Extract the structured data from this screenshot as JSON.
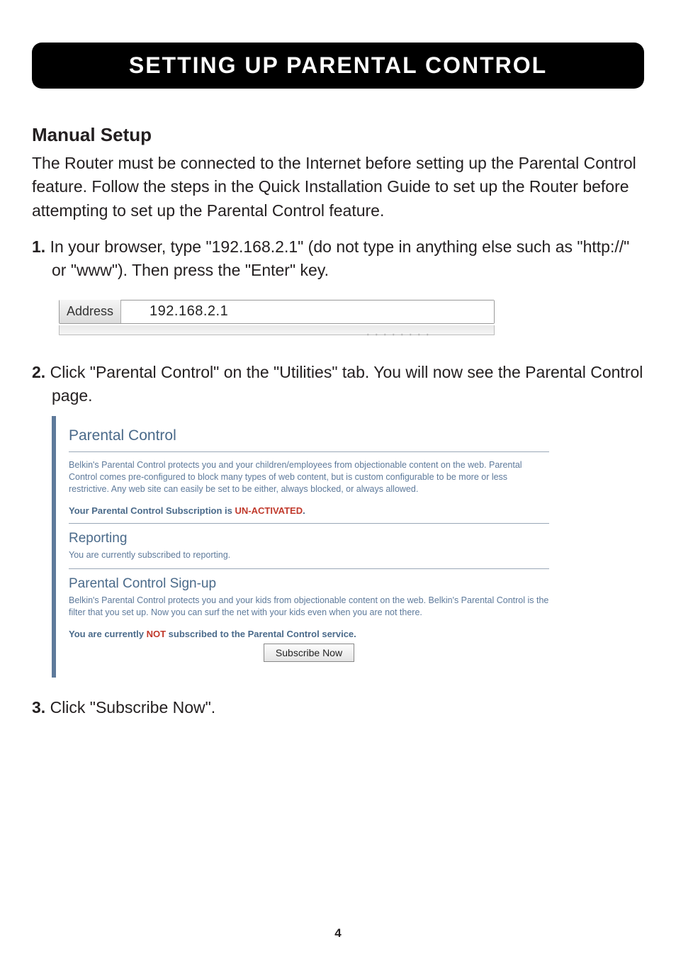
{
  "header": {
    "title": "SETTING UP PARENTAL CONTROL"
  },
  "section": {
    "title": "Manual Setup",
    "intro": "The Router must be connected to the Internet before setting up the Parental Control feature. Follow the steps in the Quick Installation Guide to set up the Router before attempting to set up the Parental Control feature."
  },
  "steps": {
    "s1_num": "1.",
    "s1_text": " In your browser, type \"192.168.2.1\" (do not type in anything else such as \"http://\" or \"www\"). Then press the \"Enter\" key.",
    "s2_num": "2.",
    "s2_text": " Click \"Parental Control\" on the \"Utilities\" tab. You will now see the Parental Control page.",
    "s3_num": "3.",
    "s3_text": " Click \"Subscribe Now\"."
  },
  "address_bar": {
    "label": "Address",
    "value": "192.168.2.1"
  },
  "panel": {
    "title": "Parental Control",
    "desc": "Belkin's Parental Control protects you and your children/employees from objectionable content on the web. Parental Control comes pre-configured to block many types of web content, but is custom configurable to be more or less restrictive. Any web site can easily be set to be either, always blocked, or always allowed.",
    "status_prefix": "Your Parental Control Subscription is ",
    "status_value": "UN-ACTIVATED",
    "status_suffix": ".",
    "reporting_title": "Reporting",
    "reporting_text": "You are currently subscribed to reporting.",
    "signup_title": "Parental Control Sign-up",
    "signup_text": "Belkin's Parental Control protects you and your kids from objectionable content on the web. Belkin's Parental Control is the filter that you set up. Now you can surf the net with your kids even when you are not there.",
    "sub_prefix": "You are currently ",
    "sub_not": "NOT",
    "sub_suffix": " subscribed to the Parental Control service.",
    "subscribe_btn": "Subscribe Now"
  },
  "page_number": "4"
}
